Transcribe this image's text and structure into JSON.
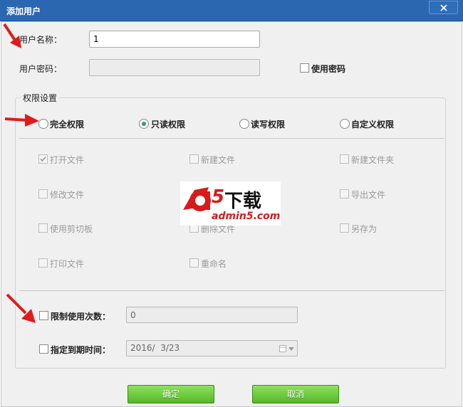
{
  "window": {
    "title": "添加用户",
    "close_icon": "close-icon"
  },
  "form": {
    "username_label": "用户名称：",
    "username_value": "1",
    "password_label": "用户密码：",
    "password_value": "",
    "use_password_label": "使用密码",
    "use_password_checked": false
  },
  "permissions": {
    "legend": "权限设置",
    "modes": [
      {
        "label": "完全权限",
        "checked": false
      },
      {
        "label": "只读权限",
        "checked": true
      },
      {
        "label": "读写权限",
        "checked": false
      },
      {
        "label": "自定义权限",
        "checked": false
      }
    ],
    "options": [
      {
        "label": "打开文件",
        "checked": true
      },
      {
        "label": "新建文件",
        "checked": false
      },
      {
        "label": "新建文件夹",
        "checked": false
      },
      {
        "label": "修改文件",
        "checked": false
      },
      {
        "label": "导出文件",
        "checked": false
      },
      {
        "label": "使用剪切板",
        "checked": false
      },
      {
        "label": "删除文件",
        "checked": false
      },
      {
        "label": "另存为",
        "checked": false
      },
      {
        "label": "打印文件",
        "checked": false
      },
      {
        "label": "重命名",
        "checked": false
      }
    ]
  },
  "limits": {
    "use_count_label": "限制使用次数：",
    "use_count_value": "0",
    "expire_label": "指定到期时间：",
    "expire_value": "2016/  3/23",
    "calendar_icon": "calendar-icon",
    "dropdown_icon": "chevron-down-icon"
  },
  "buttons": {
    "ok_label": "确定",
    "cancel_label": "取消"
  },
  "watermark": {
    "text_main": "下载",
    "text_sub": "admin5.com",
    "logo_letter": "a",
    "logo_number": "5"
  },
  "colors": {
    "titlebar": "#2b66b1",
    "button_green": "#55b827",
    "arrow_red": "#e01b1b",
    "radio_dot": "#2ea44f"
  }
}
